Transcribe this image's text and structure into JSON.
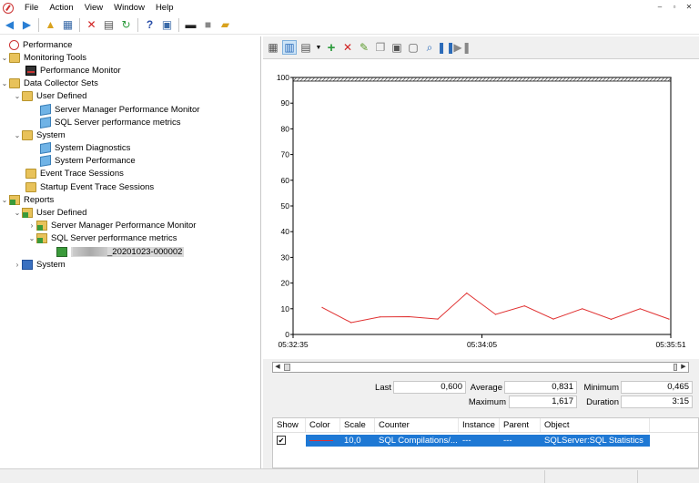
{
  "menu": {
    "items": [
      "File",
      "Action",
      "View",
      "Window",
      "Help"
    ]
  },
  "window_controls": {
    "minimize": "–",
    "restore": "▫",
    "close": "✕"
  },
  "tree": {
    "root": "Performance",
    "monitoring_tools": "Monitoring Tools",
    "performance_monitor": "Performance Monitor",
    "data_collector_sets": "Data Collector Sets",
    "dcs_user_defined": "User Defined",
    "dcs_server_manager": "Server Manager Performance Monitor",
    "dcs_sql_metrics": "SQL Server performance metrics",
    "dcs_system": "System",
    "dcs_system_diagnostics": "System Diagnostics",
    "dcs_system_performance": "System Performance",
    "event_trace_sessions": "Event Trace Sessions",
    "startup_event_trace_sessions": "Startup Event Trace Sessions",
    "reports": "Reports",
    "rep_user_defined": "User Defined",
    "rep_server_manager": "Server Manager Performance Monitor",
    "rep_sql_metrics": "SQL Server performance metrics",
    "rep_report_item": "_20201023-000002",
    "rep_system": "System"
  },
  "chart_data": {
    "type": "line",
    "y_ticks": [
      "100",
      "90",
      "80",
      "70",
      "60",
      "50",
      "40",
      "30",
      "20",
      "10",
      "0"
    ],
    "x_ticks": [
      "05:32:35",
      "05:34:05",
      "05:35:51"
    ],
    "ylim": [
      0,
      100
    ],
    "series": [
      {
        "color": "#e03030",
        "values": [
          10.5,
          4.6,
          6.8,
          6.9,
          6.0,
          16.1,
          7.8,
          11.1,
          6.0,
          10.0,
          5.9,
          10.0,
          6.0
        ]
      }
    ]
  },
  "stats": {
    "last_label": "Last",
    "last_value": "0,600",
    "average_label": "Average",
    "average_value": "0,831",
    "minimum_label": "Minimum",
    "minimum_value": "0,465",
    "maximum_label": "Maximum",
    "maximum_value": "1,617",
    "duration_label": "Duration",
    "duration_value": "3:15"
  },
  "counters": {
    "headers": [
      "Show",
      "Color",
      "Scale",
      "Counter",
      "Instance",
      "Parent",
      "Object"
    ],
    "rows": [
      {
        "show": "✔",
        "scale": "10,0",
        "counter": "SQL Compilations/...",
        "instance": "---",
        "parent": "---",
        "object": "SQLServer:SQL Statistics"
      }
    ]
  },
  "colors": {
    "line": "#e03030",
    "selection": "#1e78d4"
  }
}
